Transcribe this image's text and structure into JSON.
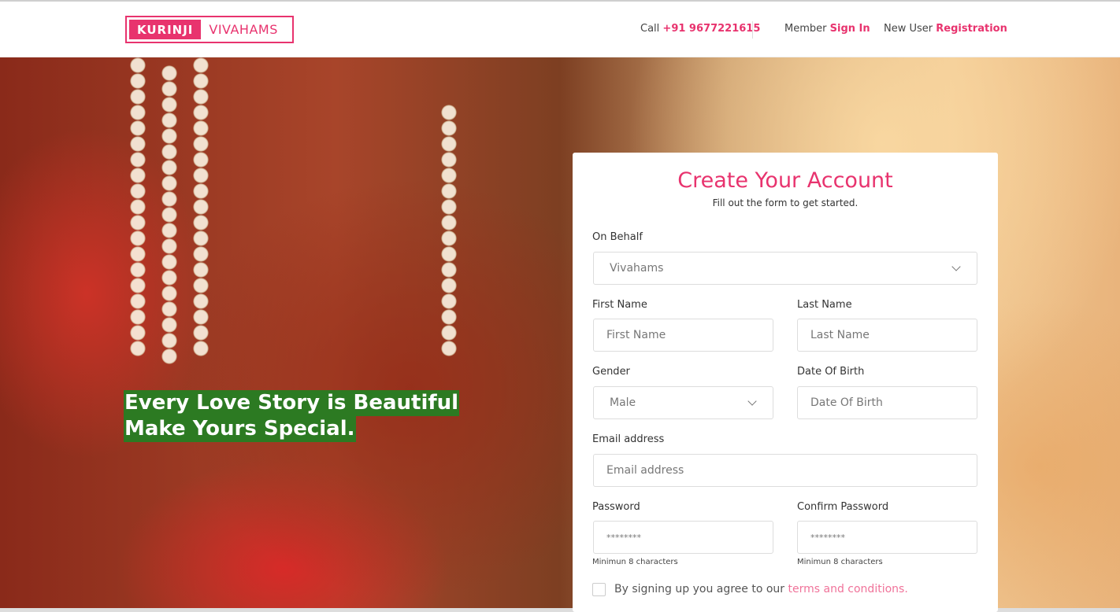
{
  "header": {
    "logo_left": "KURINJI",
    "logo_right": "VIVAHAMS",
    "call_label": "Call",
    "phone": "+91 9677221615",
    "member_label": "Member",
    "sign_in": "Sign In",
    "new_user_label": "New User",
    "registration": "Registration"
  },
  "hero": {
    "tagline_line1": "Every Love Story is Beautiful",
    "tagline_line2": "Make Yours Special."
  },
  "form": {
    "title": "Create Your Account",
    "subtitle": "Fill out the form to get started.",
    "on_behalf_label": "On Behalf",
    "on_behalf_value": "Vivahams",
    "first_name_label": "First Name",
    "first_name_placeholder": "First Name",
    "last_name_label": "Last Name",
    "last_name_placeholder": "Last Name",
    "gender_label": "Gender",
    "gender_value": "Male",
    "dob_label": "Date Of Birth",
    "dob_placeholder": "Date Of Birth",
    "email_label": "Email address",
    "email_placeholder": "Email address",
    "password_label": "Password",
    "password_placeholder": "********",
    "password_hint": "Minimun 8 characters",
    "confirm_label": "Confirm Password",
    "confirm_placeholder": "********",
    "confirm_hint": "Minimun 8 characters",
    "agree_text": "By signing up you agree to our",
    "terms_link": "terms and conditions."
  },
  "colors": {
    "accent": "#e8336e",
    "tagline_bg": "#2c7a22"
  }
}
